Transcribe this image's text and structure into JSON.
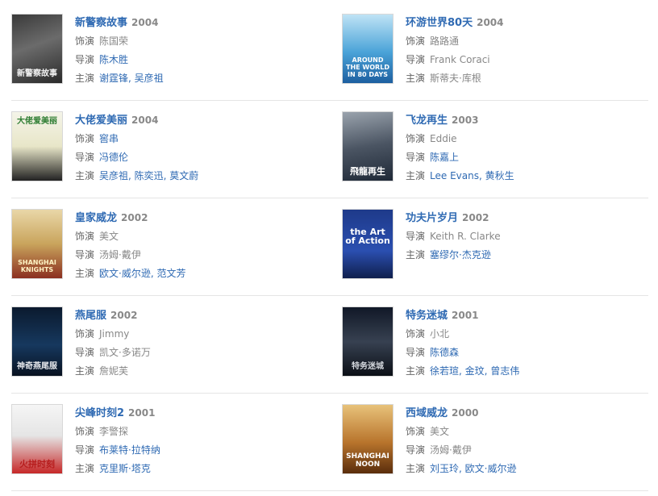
{
  "labels": {
    "role": "饰演",
    "director": "导演",
    "cast": "主演"
  },
  "colors": {
    "link": "#2f6ab3",
    "text": "#666666",
    "muted": "#888888",
    "divider": "#e5e5e5"
  },
  "movies": [
    {
      "title": "新警察故事",
      "year": "2004",
      "role": "陈国荣",
      "director": "陈木胜",
      "cast": "谢霆锋, 吴彦祖",
      "poster_text": "新警察故事"
    },
    {
      "title": "环游世界80天",
      "year": "2004",
      "role": "路路通",
      "director": "Frank Coraci",
      "cast": "斯蒂夫·库根",
      "poster_text": "AROUND THE WORLD IN 80 DAYS"
    },
    {
      "title": "大佬爱美丽",
      "year": "2004",
      "role": "窖串",
      "director": "冯德伦",
      "cast": "吴彦祖, 陈奕迅, 莫文蔚",
      "poster_text": "大佬爱美丽"
    },
    {
      "title": "飞龙再生",
      "year": "2003",
      "role": "Eddie",
      "director": "陈嘉上",
      "cast": "Lee Evans, 黄秋生",
      "poster_text": "飛龍再生"
    },
    {
      "title": "皇家威龙",
      "year": "2002",
      "role": "美文",
      "director": "汤姆·戴伊",
      "cast": "欧文·威尔逊, 范文芳",
      "poster_text": "SHANGHAI KNIGHTS"
    },
    {
      "title": "功夫片岁月",
      "year": "2002",
      "role": "",
      "director": "Keith R. Clarke",
      "cast": "塞缪尔·杰克逊",
      "poster_text": "the Art of Action"
    },
    {
      "title": "燕尾服",
      "year": "2002",
      "role": "Jimmy",
      "director": "凯文·多诺万",
      "cast": "詹妮芙",
      "poster_text": "神奇燕尾服"
    },
    {
      "title": "特务迷城",
      "year": "2001",
      "role": "小北",
      "director": "陈德森",
      "cast": "徐若瑄, 金玟, 曾志伟",
      "poster_text": "特务迷城"
    },
    {
      "title": "尖峰时刻2",
      "year": "2001",
      "role": "李警探",
      "director": "布莱特·拉特纳",
      "cast": "克里斯·塔克",
      "poster_text": "火拼时刻"
    },
    {
      "title": "西域威龙",
      "year": "2000",
      "role": "美文",
      "director": "汤姆·戴伊",
      "cast": "刘玉玲, 欧文·威尔逊",
      "poster_text": "SHANGHAI NOON"
    }
  ]
}
